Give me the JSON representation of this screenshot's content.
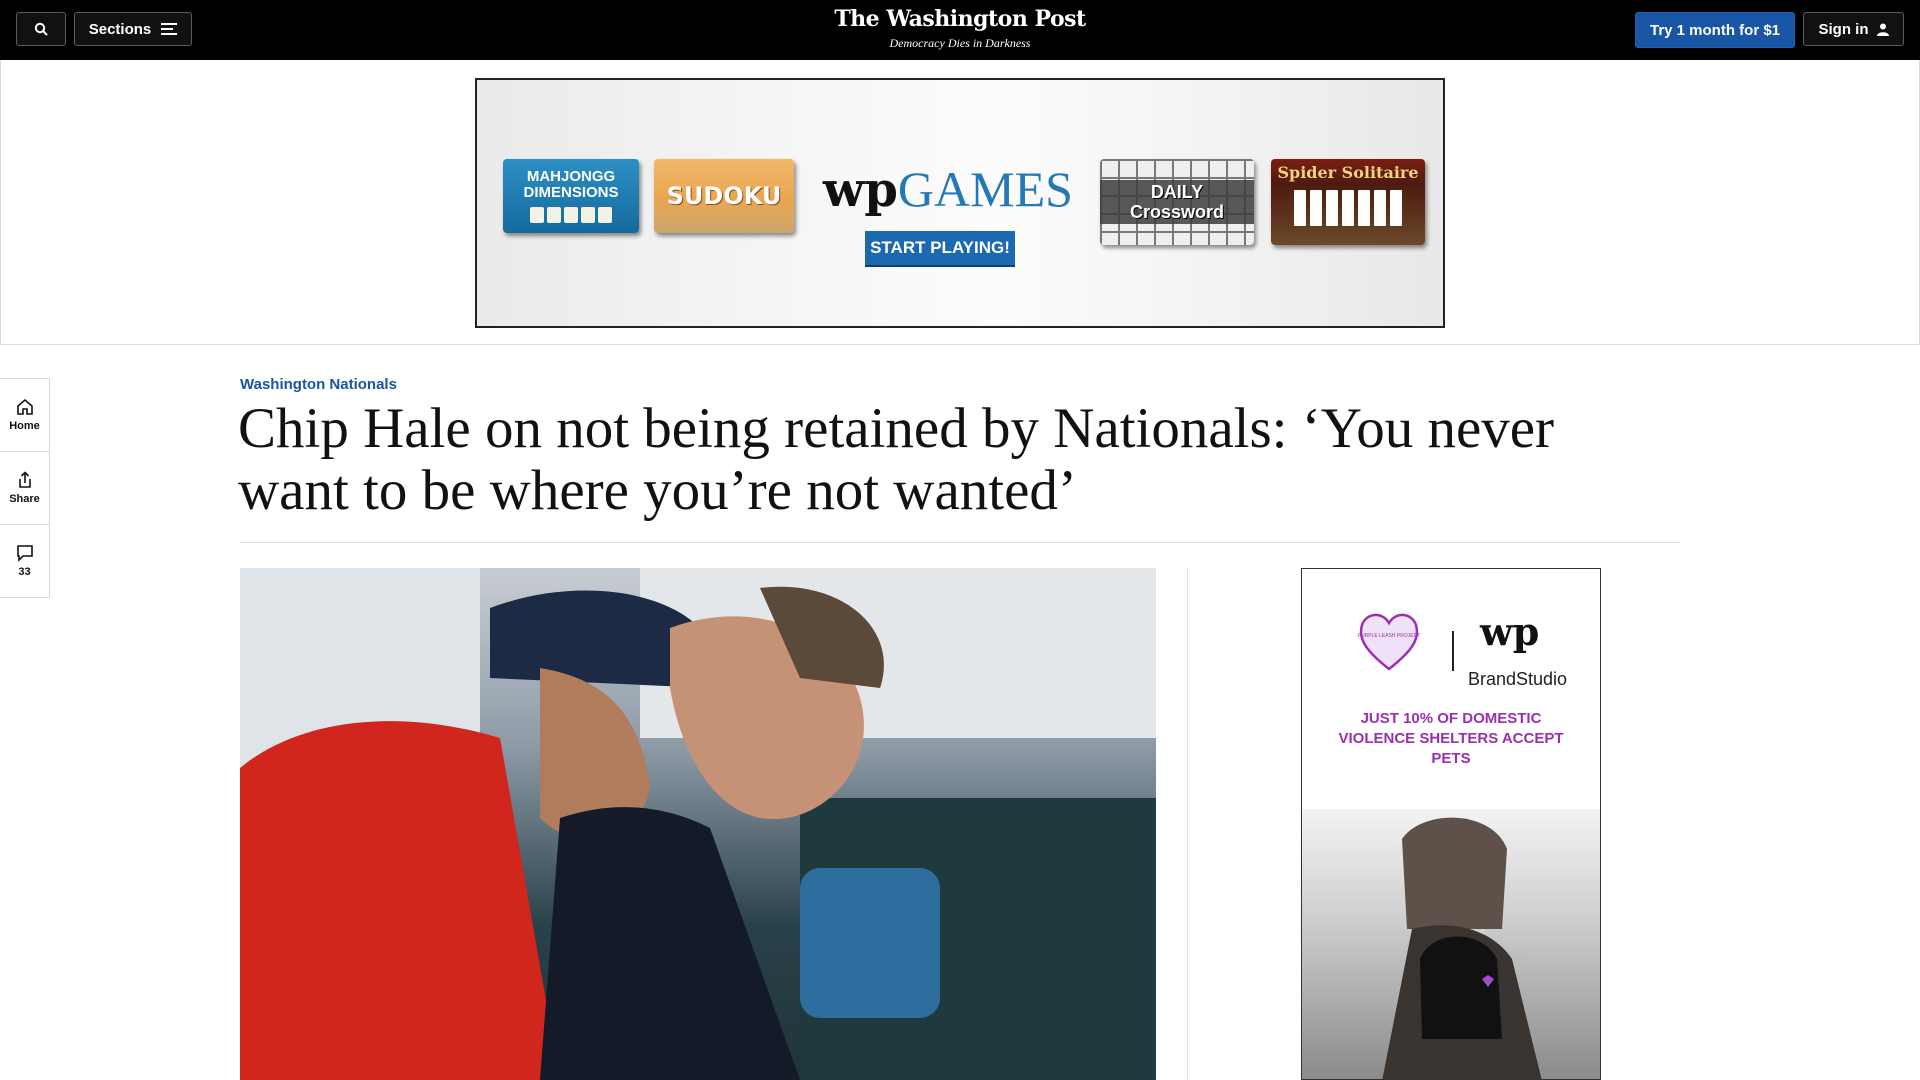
{
  "nav": {
    "search_icon": "search-icon",
    "sections_label": "Sections",
    "logo": "The Washington Post",
    "tagline": "Democracy Dies in Darkness",
    "try_label": "Try 1 month for $1",
    "signin_label": "Sign in"
  },
  "ad_banner": {
    "tiles": [
      "MAHJONGG DIMENSIONS",
      "SUDOKU",
      "DAILY Crossword",
      "Spider Solitaire"
    ],
    "brand_mark": "wp",
    "brand_word": "GAMES",
    "cta": "START PLAYING!"
  },
  "rail": {
    "home": "Home",
    "share": "Share",
    "comments_count": "33"
  },
  "article": {
    "kicker": "Washington Nationals",
    "headline": "Chip Hale on not being retained by Nationals: ‘You never want to be where you’re not wanted’"
  },
  "side_ad": {
    "partner": "PURPLE LEASH PROJECT",
    "brand_mark": "wp",
    "brand": "BrandStudio",
    "slogan": "JUST 10% OF DOMESTIC VIOLENCE SHELTERS ACCEPT PETS"
  },
  "colors": {
    "accent": "#1955a5",
    "nav_bg": "#000000",
    "ad_purple": "#9b2fb1"
  }
}
